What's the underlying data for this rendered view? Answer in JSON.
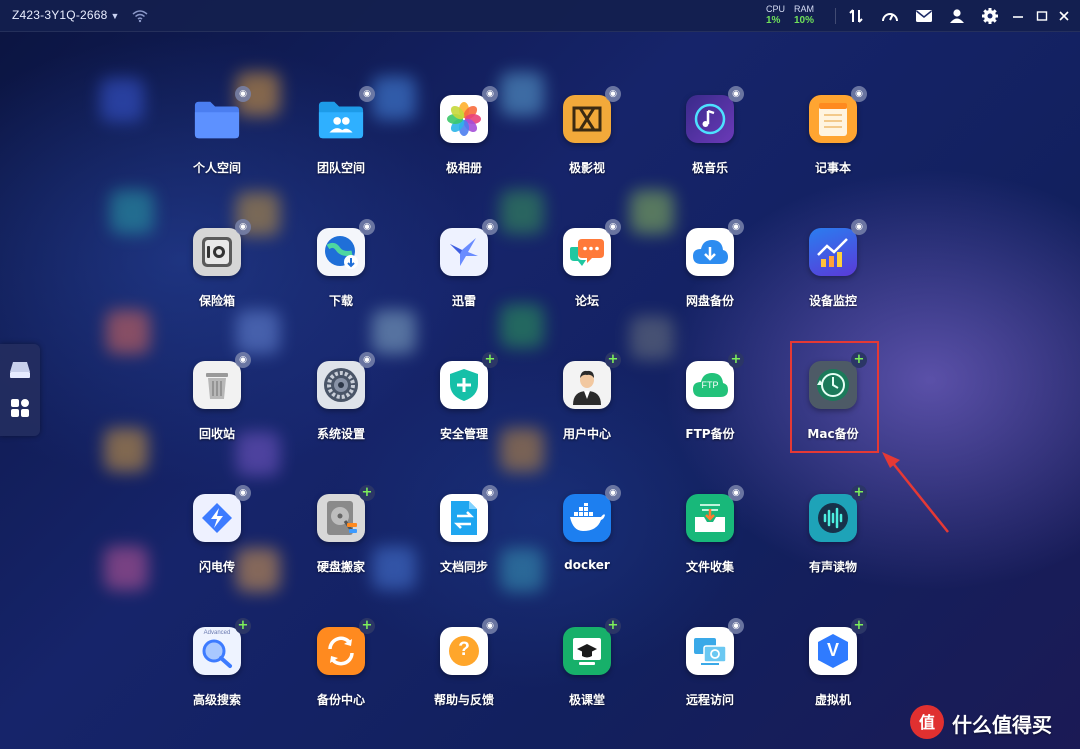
{
  "titlebar": {
    "device_name": "Z423-3Y1Q-2668",
    "cpu_label": "CPU",
    "cpu_value": "1%",
    "ram_label": "RAM",
    "ram_value": "10%",
    "icons": [
      "transfer-icon",
      "speed-icon",
      "mail-icon",
      "user-icon",
      "settings-icon",
      "minimize-icon",
      "restore-icon",
      "close-icon"
    ]
  },
  "dock": {
    "items": [
      "storage-icon",
      "app-grid-icon"
    ]
  },
  "apps": [
    {
      "label": "个人空间",
      "icon": "folder-icon",
      "badge": "installed"
    },
    {
      "label": "团队空间",
      "icon": "team-folder-icon",
      "badge": "installed"
    },
    {
      "label": "极相册",
      "icon": "photos-icon",
      "badge": "installed"
    },
    {
      "label": "极影视",
      "icon": "video-icon",
      "badge": "installed"
    },
    {
      "label": "极音乐",
      "icon": "music-icon",
      "badge": "installed"
    },
    {
      "label": "记事本",
      "icon": "notepad-icon",
      "badge": "installed"
    },
    {
      "label": "保险箱",
      "icon": "safe-icon",
      "badge": "installed"
    },
    {
      "label": "下载",
      "icon": "download-icon",
      "badge": "installed"
    },
    {
      "label": "迅雷",
      "icon": "thunder-icon",
      "badge": "installed"
    },
    {
      "label": "论坛",
      "icon": "forum-icon",
      "badge": "installed"
    },
    {
      "label": "网盘备份",
      "icon": "cloud-backup-icon",
      "badge": "installed"
    },
    {
      "label": "设备监控",
      "icon": "monitor-icon",
      "badge": "installed"
    },
    {
      "label": "回收站",
      "icon": "trash-icon",
      "badge": "installed"
    },
    {
      "label": "系统设置",
      "icon": "system-settings-icon",
      "badge": "installed"
    },
    {
      "label": "安全管理",
      "icon": "security-icon",
      "badge": "add"
    },
    {
      "label": "用户中心",
      "icon": "user-center-icon",
      "badge": "add"
    },
    {
      "label": "FTP备份",
      "icon": "ftp-icon",
      "badge": "add"
    },
    {
      "label": "Mac备份",
      "icon": "time-machine-icon",
      "badge": "add"
    },
    {
      "label": "闪电传",
      "icon": "flash-transfer-icon",
      "badge": "installed"
    },
    {
      "label": "硬盘搬家",
      "icon": "disk-migrate-icon",
      "badge": "add"
    },
    {
      "label": "文档同步",
      "icon": "doc-sync-icon",
      "badge": "installed"
    },
    {
      "label": "docker",
      "icon": "docker-icon",
      "badge": "installed"
    },
    {
      "label": "文件收集",
      "icon": "file-collect-icon",
      "badge": "installed"
    },
    {
      "label": "有声读物",
      "icon": "audiobook-icon",
      "badge": "add"
    },
    {
      "label": "高级搜索",
      "icon": "advanced-search-icon",
      "badge": "add",
      "tile_text": "Advanced"
    },
    {
      "label": "备份中心",
      "icon": "backup-center-icon",
      "badge": "add"
    },
    {
      "label": "帮助与反馈",
      "icon": "help-icon",
      "badge": "installed"
    },
    {
      "label": "极课堂",
      "icon": "classroom-icon",
      "badge": "add"
    },
    {
      "label": "远程访问",
      "icon": "remote-access-icon",
      "badge": "installed"
    },
    {
      "label": "虚拟机",
      "icon": "vm-icon",
      "badge": "add"
    }
  ],
  "ftp_tile_text": "FTP",
  "vm_tile_text": "V",
  "help_tile_text": "?",
  "watermark": {
    "text": "什么值得买",
    "glyph": "值"
  },
  "colors": {
    "accent_green": "#6fe05a",
    "highlight_red": "#e53935"
  }
}
